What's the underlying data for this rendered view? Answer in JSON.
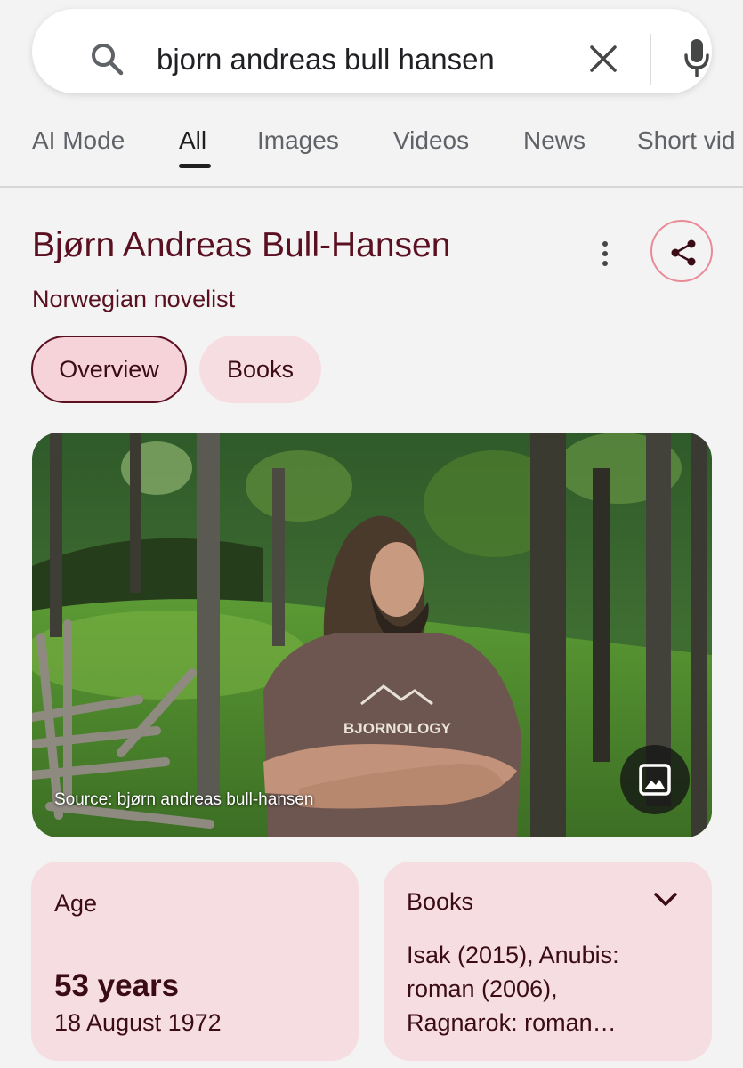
{
  "search": {
    "query": "bjorn andreas bull hansen"
  },
  "tabs": [
    {
      "label": "AI Mode",
      "active": false
    },
    {
      "label": "All",
      "active": true
    },
    {
      "label": "Images",
      "active": false
    },
    {
      "label": "Videos",
      "active": false
    },
    {
      "label": "News",
      "active": false
    },
    {
      "label": "Short vid",
      "active": false
    }
  ],
  "knowledge_panel": {
    "title": "Bjørn Andreas Bull-Hansen",
    "subtitle": "Norwegian novelist",
    "chips": [
      {
        "label": "Overview",
        "active": true
      },
      {
        "label": "Books",
        "active": false
      }
    ],
    "image": {
      "source_caption": "Source: bjørn andreas bull-hansen",
      "shirt_text": "BJORNOLOGY"
    },
    "cards": {
      "age": {
        "label": "Age",
        "value": "53 years",
        "date": "18 August 1972"
      },
      "books": {
        "label": "Books",
        "text": "Isak (2015), Anubis: roman (2006), Ragnarok: roman…"
      }
    }
  },
  "colors": {
    "accent": "#5a1020",
    "chip_bg": "#f6dde1",
    "page_bg": "#f3f3f4"
  },
  "icons": [
    "search-icon",
    "clear-icon",
    "mic-icon",
    "more-vertical-icon",
    "share-icon",
    "image-icon",
    "chevron-down-icon"
  ]
}
